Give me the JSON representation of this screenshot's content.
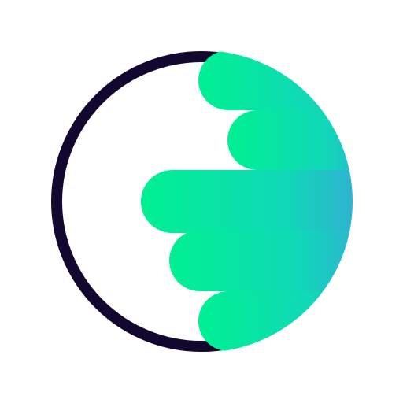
{
  "logo": {
    "ring_color": "#12082f",
    "gradient_start": "#00f091",
    "gradient_mid": "#10d8b8",
    "gradient_end": "#4399e1",
    "bar_count": 5
  }
}
